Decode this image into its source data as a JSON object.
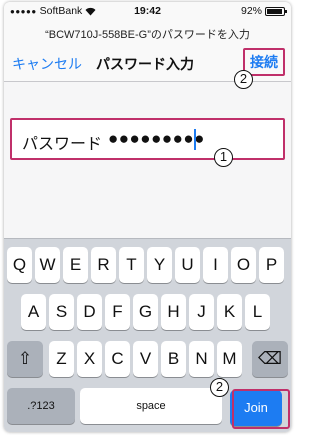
{
  "status": {
    "carrier": "SoftBank",
    "signal_dots": "●●●●●",
    "wifi_icon": "wifi-icon",
    "time": "19:42",
    "battery_text": "92%",
    "battery_level": 0.92
  },
  "nav": {
    "prompt": "“BCW710J-558BE-G”のパスワードを入力",
    "cancel": "キャンセル",
    "title": "パスワード入力",
    "connect": "接続"
  },
  "field": {
    "label": "パスワード",
    "value": "●●●●●●●●●"
  },
  "annotations": {
    "one": "1",
    "two": "2",
    "color": "#c0306a"
  },
  "keyboard": {
    "row1": [
      "Q",
      "W",
      "E",
      "R",
      "T",
      "Y",
      "U",
      "I",
      "O",
      "P"
    ],
    "row2": [
      "A",
      "S",
      "D",
      "F",
      "G",
      "H",
      "J",
      "K",
      "L"
    ],
    "row3": [
      "Z",
      "X",
      "C",
      "V",
      "B",
      "N",
      "M"
    ],
    "shift": "⇧",
    "delete": "⌫",
    "numbers": ".?123",
    "space": "space",
    "join": "Join"
  },
  "colors": {
    "accent": "#1d7cf2",
    "keyboard_bg": "#d1d5db"
  }
}
